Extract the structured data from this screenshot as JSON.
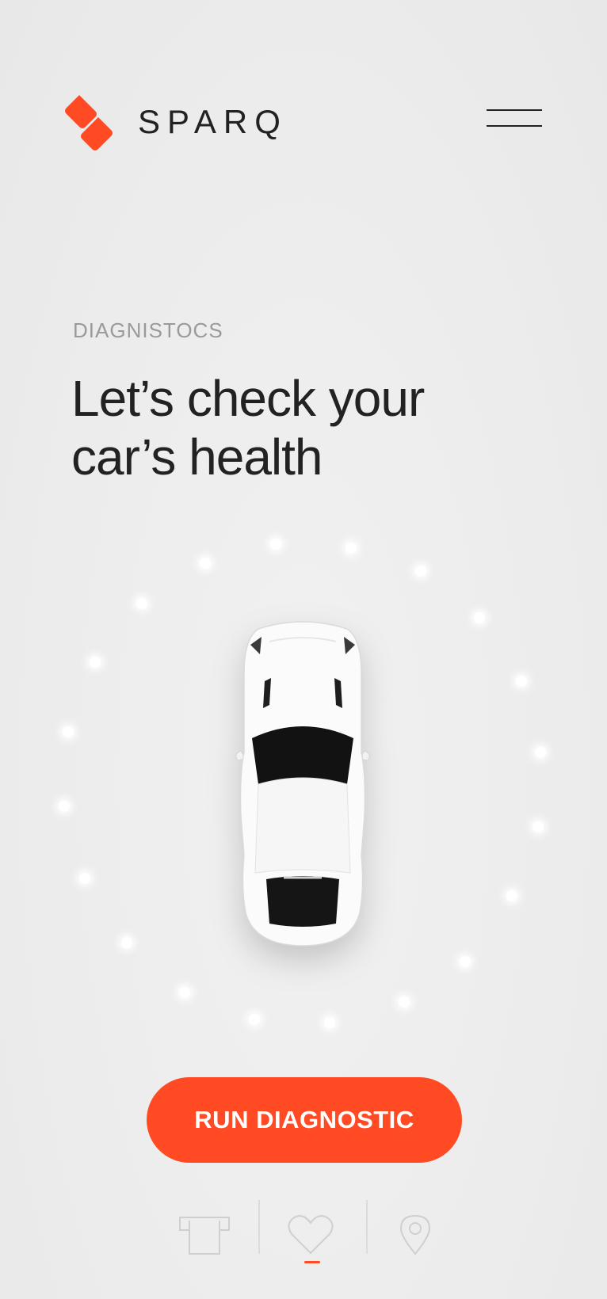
{
  "brand": {
    "name": "SPARQ",
    "accent_color": "#ff4a24"
  },
  "header": {
    "menu_icon": "hamburger-icon"
  },
  "hero": {
    "eyebrow": "DIAGNISTOCS",
    "headline_line1": "Let’s check your",
    "headline_line2": "car’s health"
  },
  "car_image": "car-top-view",
  "cta": {
    "label": "RUN DIAGNOSTIC"
  },
  "bottom_nav": {
    "items": [
      {
        "icon": "tshirt-icon",
        "active": false
      },
      {
        "icon": "heart-icon",
        "active": true
      },
      {
        "icon": "location-pin-icon",
        "active": false
      }
    ]
  }
}
